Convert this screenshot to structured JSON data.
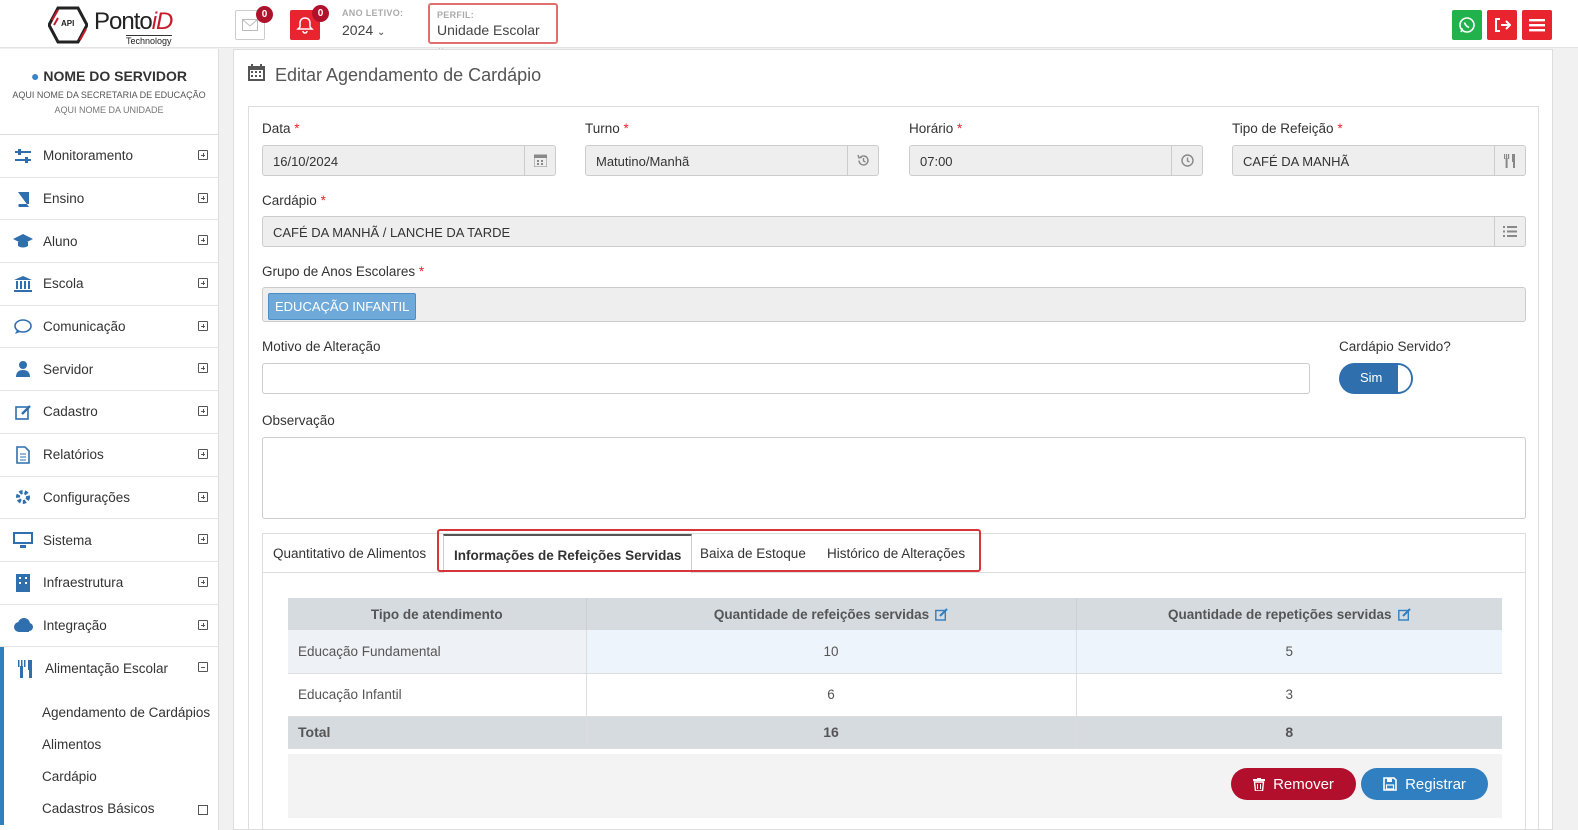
{
  "header": {
    "logo_tag": "API",
    "logo_brand_main": "Ponto",
    "logo_brand_accent": "iD",
    "logo_sub": "Technology",
    "messages_count": "0",
    "notifications_count": "0",
    "ano_letivo_label": "ANO LETIVO:",
    "ano_letivo_value": "2024",
    "perfil_label": "PERFIL:",
    "perfil_value": "Unidade Escolar"
  },
  "sidebar": {
    "user_name": "NOME DO SERVIDOR",
    "secretaria": "AQUI NOME DA SECRETARIA DE EDUCAÇÃO",
    "unidade": "AQUI NOME DA UNIDADE",
    "items": [
      {
        "label": "Monitoramento",
        "icon": "sliders-icon"
      },
      {
        "label": "Ensino",
        "icon": "book-icon"
      },
      {
        "label": "Aluno",
        "icon": "graduation-cap-icon"
      },
      {
        "label": "Escola",
        "icon": "institution-icon"
      },
      {
        "label": "Comunicação",
        "icon": "chat-bubble-icon"
      },
      {
        "label": "Servidor",
        "icon": "user-icon"
      },
      {
        "label": "Cadastro",
        "icon": "edit-icon"
      },
      {
        "label": "Relatórios",
        "icon": "document-icon"
      },
      {
        "label": "Configurações",
        "icon": "gear-icon"
      },
      {
        "label": "Sistema",
        "icon": "desktop-icon"
      },
      {
        "label": "Infraestrutura",
        "icon": "building-icon"
      },
      {
        "label": "Integração",
        "icon": "cloud-icon"
      },
      {
        "label": "Alimentação Escolar",
        "icon": "cutlery-icon"
      }
    ],
    "submenu": [
      "Agendamento de Cardápios",
      "Alimentos",
      "Cardápio",
      "Cadastros Básicos"
    ]
  },
  "page": {
    "title": "Editar Agendamento de Cardápio"
  },
  "form": {
    "data_label": "Data",
    "data_value": "16/10/2024",
    "turno_label": "Turno",
    "turno_value": "Matutino/Manhã",
    "horario_label": "Horário",
    "horario_value": "07:00",
    "tipo_label": "Tipo de Refeição",
    "tipo_value": "CAFÉ DA MANHÃ",
    "cardapio_label": "Cardápio",
    "cardapio_value": "CAFÉ DA MANHÃ / LANCHE DA TARDE",
    "grupo_label": "Grupo de Anos Escolares",
    "grupo_tag": "EDUCAÇÃO INFANTIL",
    "motivo_label": "Motivo de Alteração",
    "motivo_value": "",
    "servido_label": "Cardápio Servido?",
    "servido_value": "Sim",
    "observacao_label": "Observação",
    "observacao_value": "",
    "required_mark": "*"
  },
  "tabs": [
    {
      "label": "Quantitativo de Alimentos",
      "active": false
    },
    {
      "label": "Informações de Refeições Servidas",
      "active": true
    },
    {
      "label": "Baixa de Estoque",
      "active": false
    },
    {
      "label": "Histórico de Alterações",
      "active": false
    }
  ],
  "table": {
    "headers": [
      "Tipo de atendimento",
      "Quantidade de refeições servidas",
      "Quantidade de repetições servidas"
    ],
    "rows": [
      [
        "Educação Fundamental",
        "10",
        "5"
      ],
      [
        "Educação Infantil",
        "6",
        "3"
      ]
    ],
    "total": [
      "Total",
      "16",
      "8"
    ]
  },
  "actions": {
    "remove_label": "Remover",
    "save_label": "Registrar"
  },
  "colors": {
    "accent_blue": "#2f7fc1",
    "danger_red": "#e8242e",
    "remove_red": "#b20f2c",
    "whatsapp_green": "#22b24c"
  }
}
